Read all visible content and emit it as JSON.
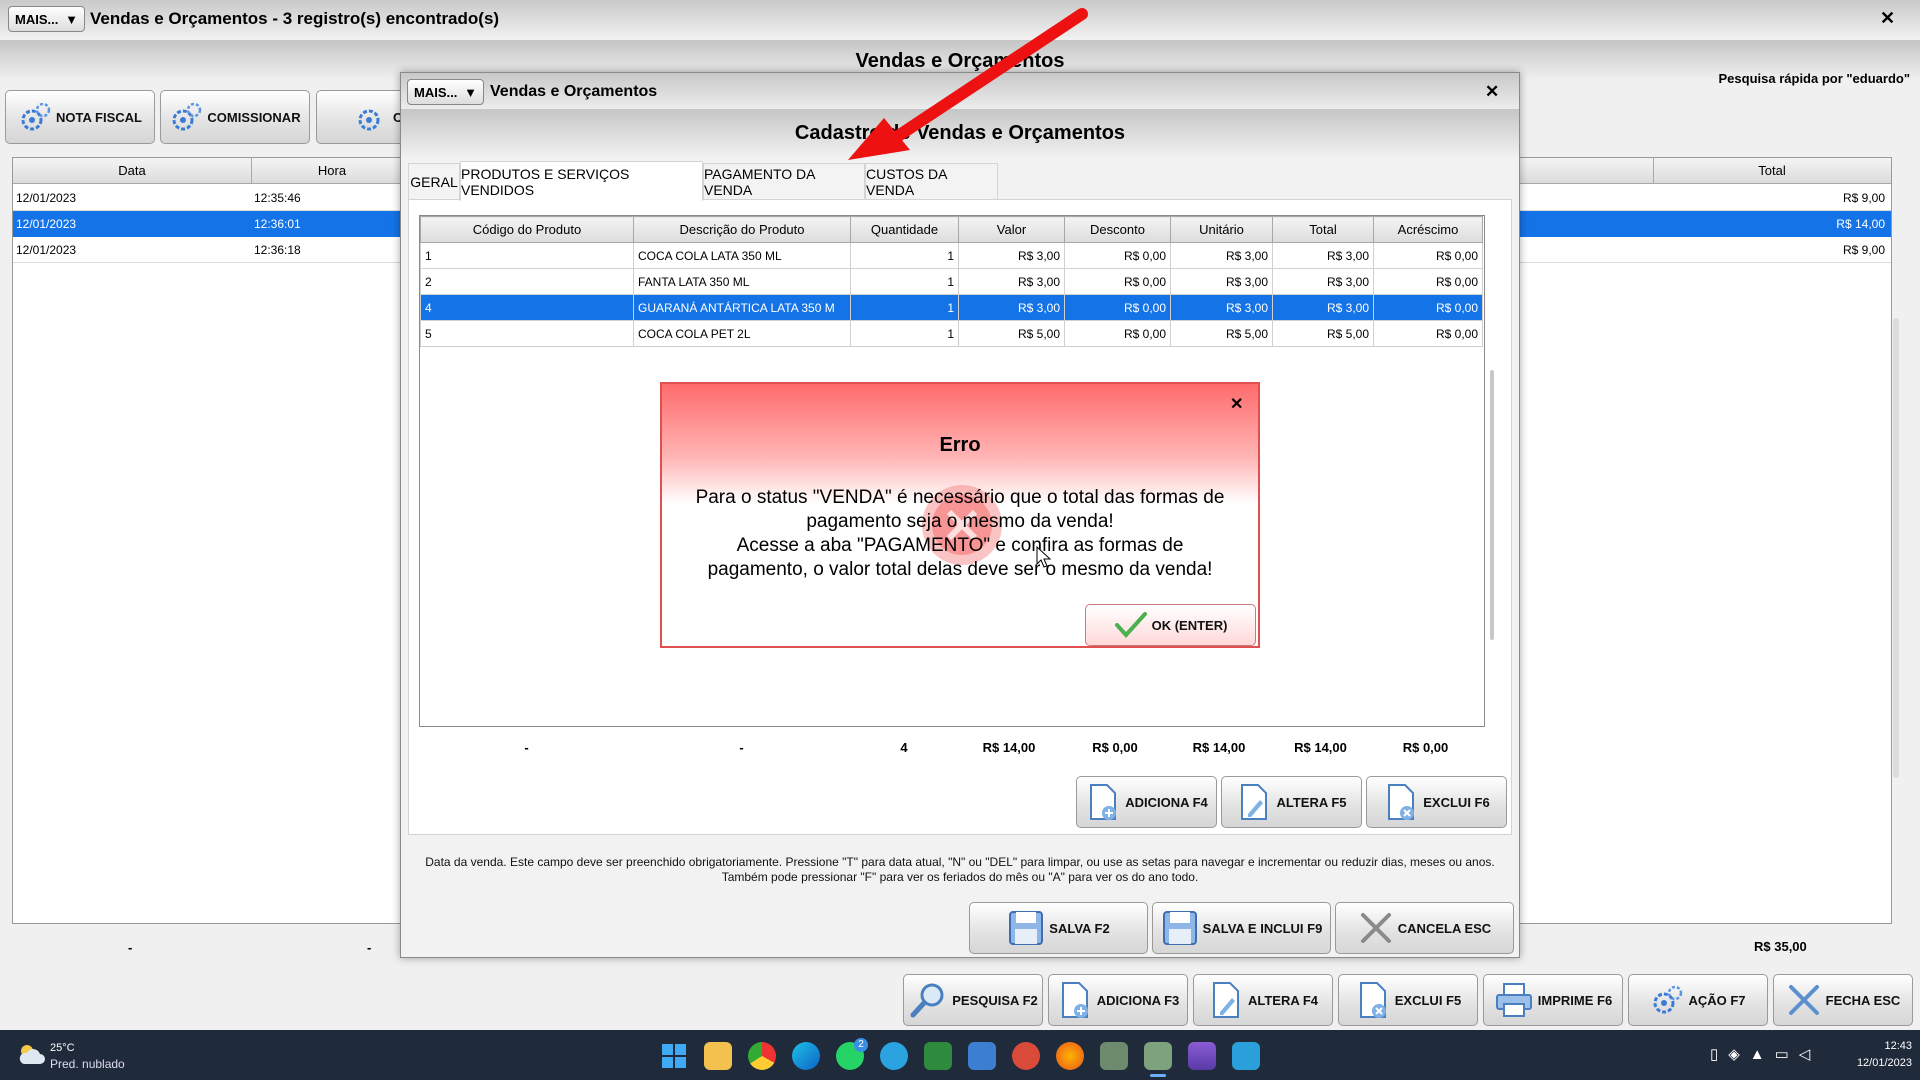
{
  "main_window": {
    "mais_label": "MAIS...",
    "title": "Vendas e Orçamentos - 3 registro(s) encontrado(s)",
    "heading": "Vendas e Orçamentos",
    "quick_search": "Pesquisa rápida por \"eduardo\"",
    "close": "✕",
    "buttons": {
      "nota_fiscal": "NOTA FISCAL",
      "comissionar": "COMISSIONAR",
      "partial": "C"
    },
    "columns": {
      "data": "Data",
      "hora": "Hora",
      "total": "Total"
    },
    "rows": [
      {
        "data": "12/01/2023",
        "hora": "12:35:46",
        "total": "R$ 9,00"
      },
      {
        "data": "12/01/2023",
        "hora": "12:36:01",
        "total": "R$ 14,00"
      },
      {
        "data": "12/01/2023",
        "hora": "12:36:18",
        "total": "R$ 9,00"
      }
    ],
    "footer": {
      "dash1": "-",
      "dash2": "-",
      "total": "R$ 35,00"
    },
    "bottom_buttons": {
      "pesquisa": "PESQUISA F2",
      "adiciona": "ADICIONA F3",
      "altera": "ALTERA F4",
      "exclui": "EXCLUI F5",
      "imprime": "IMPRIME F6",
      "acao": "AÇÃO F7",
      "fecha": "FECHA ESC"
    }
  },
  "dialog": {
    "mais_label": "MAIS...",
    "title": "Vendas e Orçamentos",
    "heading": "Cadastro de Vendas e Orçamentos",
    "close": "✕",
    "tabs": [
      "GERAL",
      "PRODUTOS E SERVIÇOS VENDIDOS",
      "PAGAMENTO DA VENDA",
      "CUSTOS DA VENDA"
    ],
    "columns": [
      "Código do Produto",
      "Descrição do Produto",
      "Quantidade",
      "Valor",
      "Desconto",
      "Unitário",
      "Total",
      "Acréscimo"
    ],
    "rows": [
      [
        "1",
        "COCA COLA LATA 350 ML",
        "1",
        "R$ 3,00",
        "R$ 0,00",
        "R$ 3,00",
        "R$ 3,00",
        "R$ 0,00"
      ],
      [
        "2",
        "FANTA LATA 350 ML",
        "1",
        "R$ 3,00",
        "R$ 0,00",
        "R$ 3,00",
        "R$ 3,00",
        "R$ 0,00"
      ],
      [
        "4",
        "GUARANÁ ANTÁRTICA LATA 350 M",
        "1",
        "R$ 3,00",
        "R$ 0,00",
        "R$ 3,00",
        "R$ 3,00",
        "R$ 0,00"
      ],
      [
        "5",
        "COCA COLA PET 2L",
        "1",
        "R$ 5,00",
        "R$ 0,00",
        "R$ 5,00",
        "R$ 5,00",
        "R$ 0,00"
      ]
    ],
    "totals": {
      "codigo": "-",
      "descricao": "-",
      "quantidade": "4",
      "valor": "R$ 14,00",
      "desconto": "R$ 0,00",
      "unitario": "R$ 14,00",
      "total": "R$ 14,00",
      "acrescimo": "R$ 0,00"
    },
    "item_buttons": {
      "adiciona": "ADICIONA F4",
      "altera": "ALTERA F5",
      "exclui": "EXCLUI F6"
    },
    "hint": "Data da venda. Este campo deve ser preenchido obrigatoriamente. Pressione \"T\" para data atual, \"N\" ou \"DEL\" para limpar, ou use as setas para navegar e incrementar ou reduzir dias, meses ou anos. Também pode pressionar \"F\" para ver os feriados do mês ou \"A\" para ver os do ano todo.",
    "action_buttons": {
      "salva": "SALVA F2",
      "salva_inclui": "SALVA E INCLUI F9",
      "cancela": "CANCELA ESC"
    }
  },
  "error": {
    "title": "Erro",
    "close": "✕",
    "line1": "Para o status \"VENDA\" é necessário que o total das formas de",
    "line2": "pagamento seja o mesmo da venda!",
    "line3": "Acesse a aba \"PAGAMENTO\" e confira as formas de",
    "line4": "pagamento, o valor total delas deve ser o mesmo da venda!",
    "ok": "OK (ENTER)"
  },
  "taskbar": {
    "temp": "25°C",
    "weather": "Pred. nublado",
    "time": "12:43",
    "date": "12/01/2023",
    "whatsapp_badge": "2"
  },
  "colors": {
    "selection": "#1473e6",
    "error_header": "#ff6b6b",
    "arrow": "#ee1111"
  }
}
